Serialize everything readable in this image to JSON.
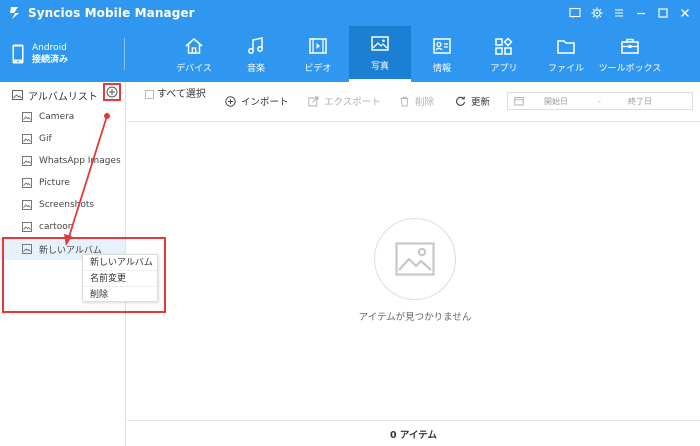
{
  "window": {
    "title": "Syncios Mobile Manager",
    "controls": [
      "message-icon",
      "gear-icon",
      "menu-icon",
      "minimize-icon",
      "maximize-icon",
      "close-icon"
    ]
  },
  "device": {
    "name": "Android",
    "status": "接続済み"
  },
  "nav": {
    "tabs": [
      {
        "label": "デバイス",
        "icon": "home-icon",
        "active": false
      },
      {
        "label": "音楽",
        "icon": "music-icon",
        "active": false
      },
      {
        "label": "ビデオ",
        "icon": "video-icon",
        "active": false
      },
      {
        "label": "写真",
        "icon": "photo-icon",
        "active": true
      },
      {
        "label": "情報",
        "icon": "contact-card-icon",
        "active": false
      },
      {
        "label": "アプリ",
        "icon": "apps-icon",
        "active": false
      },
      {
        "label": "ファイル",
        "icon": "folder-icon",
        "active": false
      },
      {
        "label": "ツールボックス",
        "icon": "toolbox-icon",
        "active": false
      }
    ]
  },
  "sidebar": {
    "header": "アルバムリスト",
    "albums": [
      {
        "label": "Camera"
      },
      {
        "label": "Gif"
      },
      {
        "label": "WhatsApp Images"
      },
      {
        "label": "Picture"
      },
      {
        "label": "Screenshots"
      },
      {
        "label": "cartoon"
      },
      {
        "label": "新しいアルバム",
        "selected": true
      }
    ]
  },
  "context_menu": {
    "items": [
      {
        "label": "新しいアルバム"
      },
      {
        "label": "名前変更"
      },
      {
        "label": "削除"
      }
    ]
  },
  "toolbar": {
    "select_all": "すべて選択",
    "import": "インポート",
    "export": "エクスポート",
    "delete": "削除",
    "refresh": "更新",
    "start_date": "開始日",
    "date_sep": "-",
    "end_date": "終了日"
  },
  "main": {
    "empty_message": "アイテムが見つかりません"
  },
  "footer": {
    "count": "0 アイテム"
  },
  "colors": {
    "brand": "#2f97f0",
    "active_tab": "#1b7fd3",
    "highlight": "#e23a3a"
  }
}
